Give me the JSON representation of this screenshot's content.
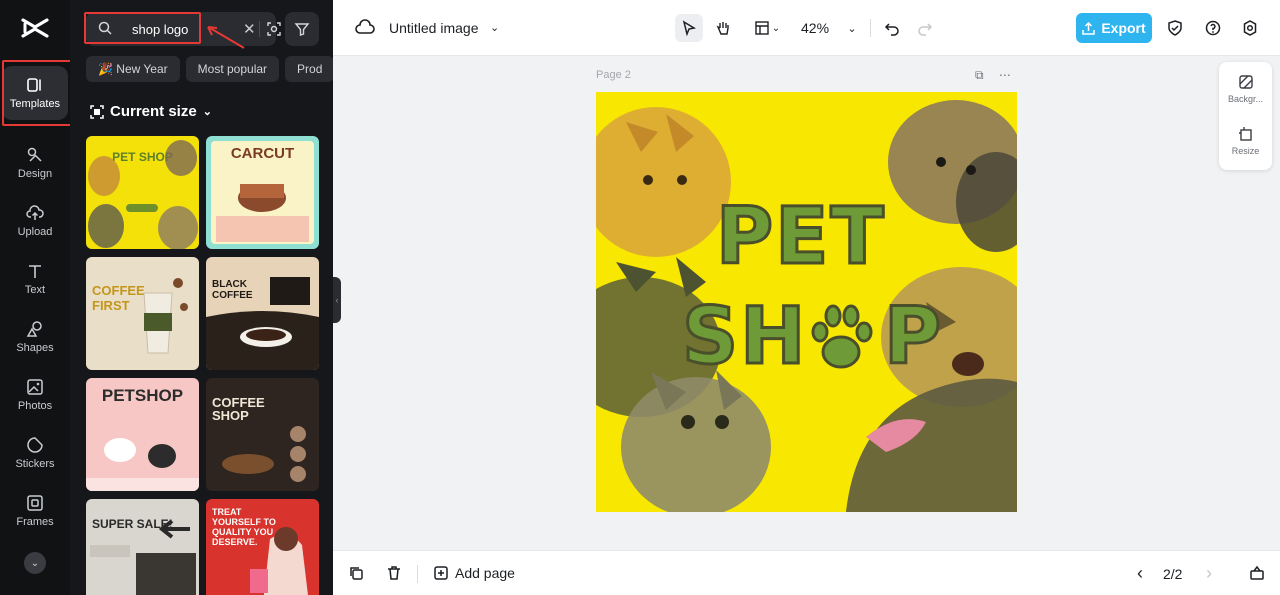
{
  "rail": {
    "items": [
      {
        "label": "Templates",
        "icon": "templates-icon"
      },
      {
        "label": "Design",
        "icon": "design-icon"
      },
      {
        "label": "Upload",
        "icon": "upload-icon"
      },
      {
        "label": "Text",
        "icon": "text-icon"
      },
      {
        "label": "Shapes",
        "icon": "shapes-icon"
      },
      {
        "label": "Photos",
        "icon": "photos-icon"
      },
      {
        "label": "Stickers",
        "icon": "stickers-icon"
      },
      {
        "label": "Frames",
        "icon": "frames-icon"
      }
    ],
    "active": "Templates"
  },
  "panel": {
    "search_value": "shop logo",
    "chips": [
      "🎉 New Year",
      "Most popular",
      "Prod"
    ],
    "size_title": "Current size",
    "templates": [
      {
        "title": "PET SHOP",
        "bg": "#f4e10a",
        "fg": "#5c7f2a"
      },
      {
        "title": "CARCUT",
        "bg": "#8fe0d2",
        "fg": "#7a3b22"
      },
      {
        "title": "COFFEE FIRST",
        "bg": "#e9dfc9",
        "fg": "#c4961b"
      },
      {
        "title": "BLACK COFFEE",
        "bg": "#e7d3b7",
        "fg": "#1f1a16"
      },
      {
        "title": "PETSHOP",
        "bg": "#f6c7c4",
        "fg": "#2c2c2c"
      },
      {
        "title": "COFFEE SHOP",
        "bg": "#2e2520",
        "fg": "#f2e6d6"
      },
      {
        "title": "SUPER SALE!",
        "bg": "#d9d6cf",
        "fg": "#2a2a2a"
      },
      {
        "title": "TREAT YOURSELF TO QUALITY YOU DESERVE.",
        "bg": "#d8332c",
        "fg": "#ffffff"
      }
    ]
  },
  "topbar": {
    "title": "Untitled image",
    "zoom": "42%",
    "export_label": "Export"
  },
  "canvas": {
    "page_label": "Page 2",
    "design_line1": "PET",
    "design_line2_a": "SH",
    "design_line2_b": "P",
    "colors": {
      "background": "#f8e700",
      "text_fill": "#6e9a38",
      "text_stroke": "#4a4f2b"
    }
  },
  "mini_panel": {
    "background_label": "Backgr...",
    "resize_label": "Resize"
  },
  "bottombar": {
    "add_page_label": "Add page",
    "pager": "2/2"
  }
}
